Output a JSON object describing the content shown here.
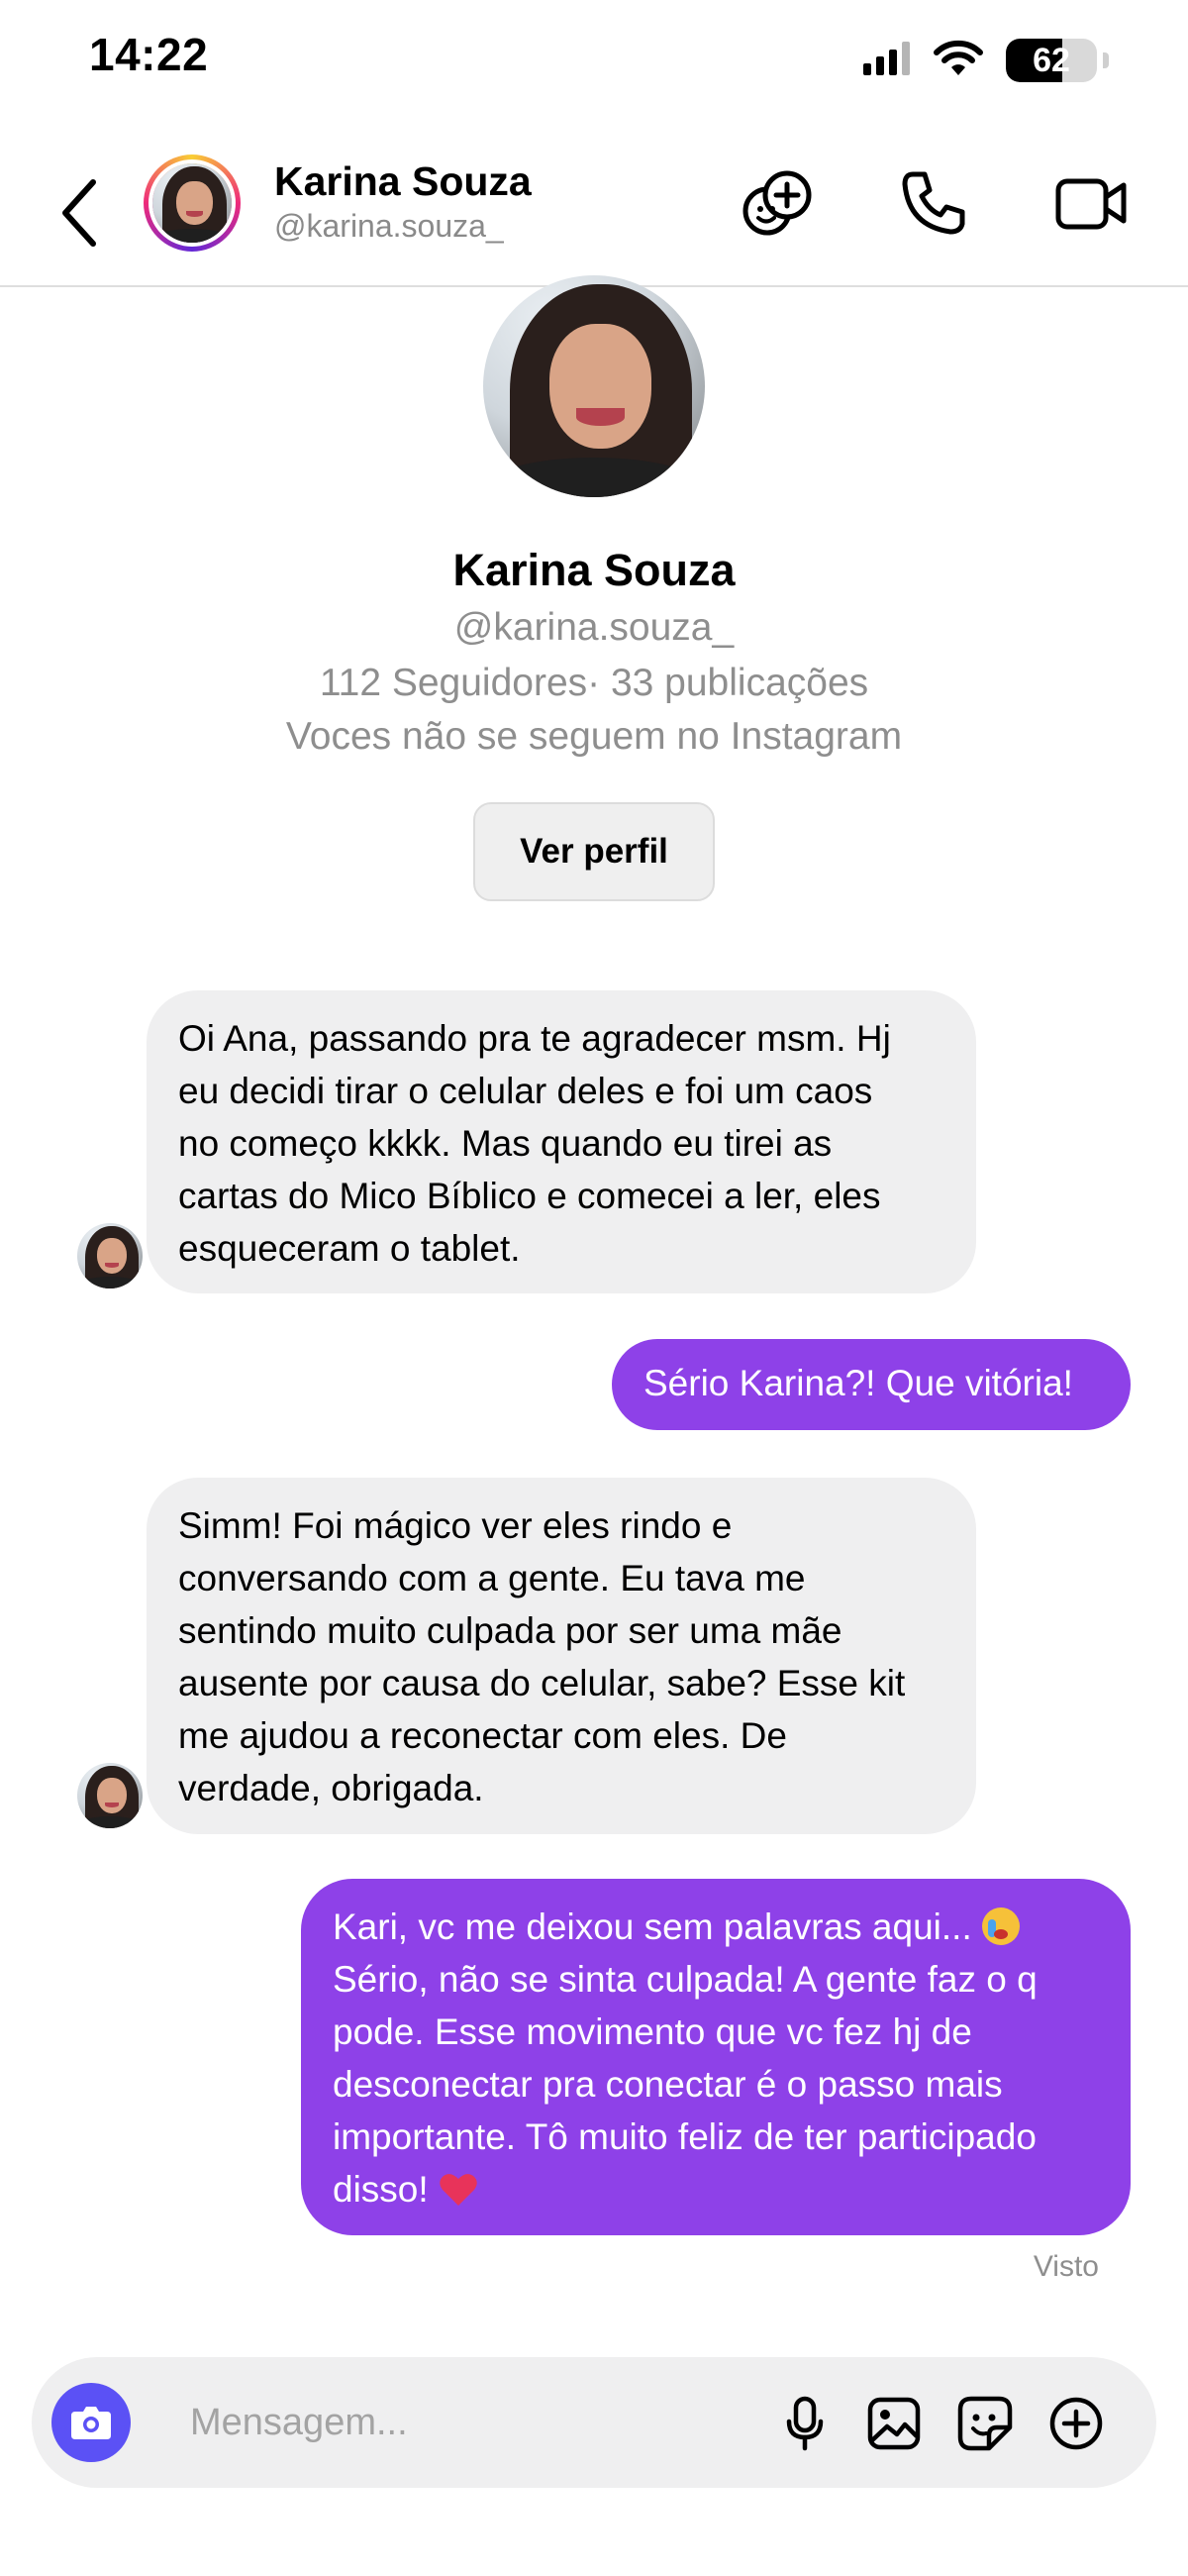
{
  "status_bar": {
    "time": "14:22",
    "battery_level": "62",
    "battery_fraction": 0.62,
    "icons": [
      "signal-icon",
      "wifi-icon",
      "battery-icon"
    ]
  },
  "header": {
    "name": "Karina Souza",
    "handle": "@karina.souza_",
    "actions": [
      "add-people-icon",
      "phone-icon",
      "video-icon"
    ]
  },
  "profile": {
    "name": "Karina Souza",
    "handle": "@karina.souza_",
    "stats": "112 Seguidores· 33 publicações",
    "follow_status": "Voces não se seguem no Instagram",
    "view_profile_label": "Ver perfil"
  },
  "messages": [
    {
      "direction": "in",
      "lines": [
        "Oi Ana, passando pra te agradecer msm. Hj",
        "eu decidi tirar o celular deles e foi um caos",
        "no começo kkkk. Mas quando eu tirei as",
        "cartas do Mico Bíblico e comecei a ler, eles",
        "esqueceram o tablet."
      ]
    },
    {
      "direction": "out",
      "lines": [
        "Sério Karina?! Que vitória!"
      ]
    },
    {
      "direction": "in",
      "lines": [
        "Simm! Foi mágico ver eles rindo e",
        "conversando com a gente. Eu tava me",
        "sentindo muito culpada por ser uma mãe",
        "ausente por causa do celular, sabe? Esse kit",
        "me ajudou a reconectar com eles. De",
        "verdade, obrigada."
      ]
    },
    {
      "direction": "out",
      "lines": [
        "Kari, vc me deixou sem palavras aqui...",
        "Sério, não se sinta culpada! A gente faz o q",
        "pode. Esse movimento que vc fez hj de",
        "desconectar pra conectar é o passo mais",
        "importante. Tô muito feliz de ter participado",
        "disso!"
      ],
      "emojis": [
        "loudly-crying-face-emoji",
        "heart-emoji"
      ]
    }
  ],
  "seen_label": "Visto",
  "composer": {
    "placeholder": "Mensagem...",
    "icons": [
      "camera-icon",
      "microphone-icon",
      "image-icon",
      "sticker-icon",
      "plus-circle-icon"
    ]
  },
  "colors": {
    "outgoing_bubble": "#8e41e8",
    "incoming_bubble": "#efeff0",
    "camera_button": "#5b51f5",
    "secondary_text": "#8e8e8e"
  }
}
